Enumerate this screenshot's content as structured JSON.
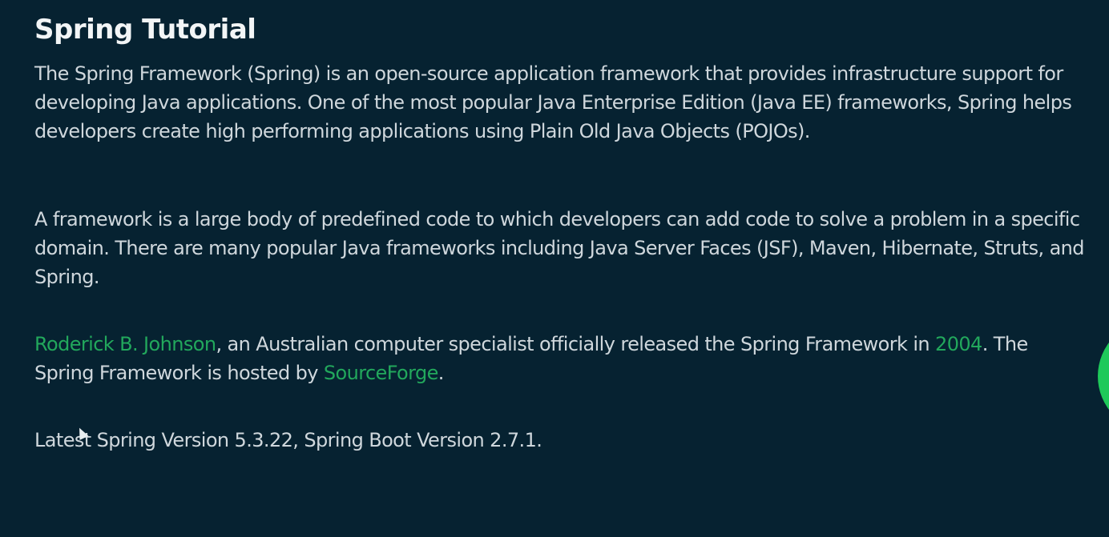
{
  "title": "Spring Tutorial",
  "paragraphs": {
    "p1": "The Spring Framework (Spring) is an open-source application framework that provides infrastructure support for developing Java applications. One of the most popular Java Enterprise Edition (Java EE) frameworks, Spring helps developers create high performing applications using Plain Old Java Objects (POJOs).",
    "p2": "A framework is a large body of predefined code to which developers can add code to solve a problem in a specific domain. There are many popular Java frameworks including Java Server Faces (JSF), Maven, Hibernate, Struts, and Spring.",
    "p3": {
      "link_author": "Roderick B. Johnson",
      "text1": ", an Australian computer specialist officially released the Spring Framework in ",
      "link_year": "2004",
      "text2": ". The Spring Framework is hosted by ",
      "link_host": "SourceForge",
      "text3": "."
    },
    "p4": "Latest Spring Version 5.3.22, Spring Boot Version 2.7.1."
  },
  "colors": {
    "background": "#062231",
    "link": "#22a85c",
    "accent_circle": "#1ec95a"
  },
  "icons": {
    "cursor": "mouse-pointer-icon"
  }
}
